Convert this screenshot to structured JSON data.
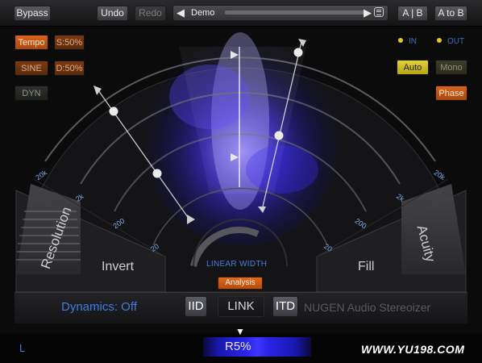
{
  "toolbar": {
    "bypass": "Bypass",
    "undo": "Undo",
    "redo": "Redo",
    "preset_name": "Demo",
    "ab": "A | B",
    "atob": "A to B"
  },
  "left_buttons": {
    "tempo": "Tempo",
    "sync_s": "S:50%",
    "sine": "SINE",
    "d": "D:50%",
    "dyn": "DYN"
  },
  "right_controls": {
    "in": "IN",
    "out": "OUT",
    "auto": "Auto",
    "mono": "Mono",
    "phase": "Phase"
  },
  "panels": {
    "resolution": "Resolution",
    "invert": "Invert",
    "fill": "Fill",
    "acuity": "Acuity"
  },
  "freq_ticks_left": [
    "20k",
    "2k",
    "200",
    "20"
  ],
  "freq_ticks_right": [
    "2k",
    "200",
    "20k",
    "20"
  ],
  "knob": {
    "label": "LINEAR WIDTH",
    "analysis": "Analysis"
  },
  "bottom": {
    "dynamics": "Dynamics: Off",
    "iid": "IID",
    "link": "LINK",
    "itd": "ITD",
    "brand": "NUGEN Audio Stereoizer"
  },
  "meter": {
    "left_label": "L",
    "value": "R5%",
    "watermark": "WWW.YU198.COM"
  },
  "colors": {
    "accent_orange": "#d8631c",
    "accent_blue": "#3f7ddf",
    "auto_yellow": "#e0d234"
  }
}
